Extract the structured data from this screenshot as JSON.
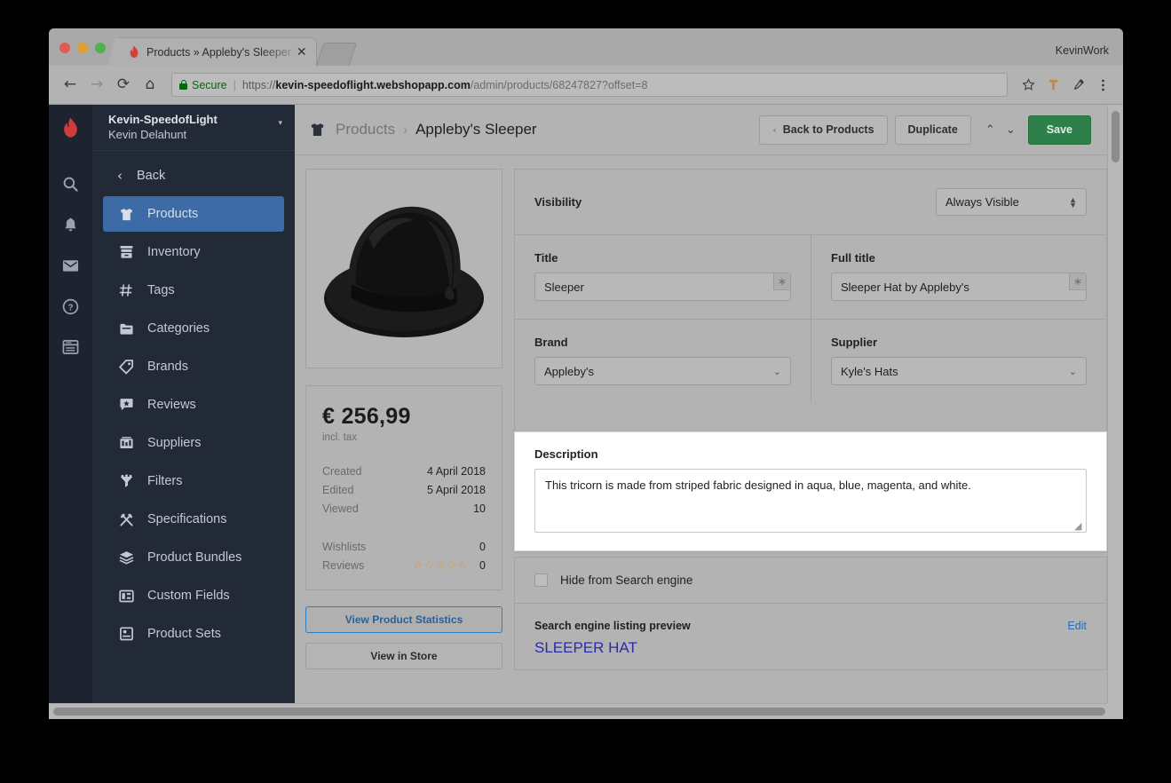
{
  "browser": {
    "traffic_lights": [
      "close",
      "minimize",
      "maximize"
    ],
    "tab": {
      "favicon": "flame-icon",
      "title": "Products » Appleby's Sleeper",
      "close_label": "✕"
    },
    "profile_label": "KevinWork",
    "nav": {
      "back": "←",
      "forward": "→",
      "reload": "⟳",
      "home": "⌂"
    },
    "url": {
      "secure_label": "Secure",
      "separator": "|",
      "scheme": "https://",
      "host": "kevin-speedoflight.webshopapp.com",
      "path": "/admin/products/68247827?offset=8",
      "full": "https://kevin-speedoflight.webshopapp.com/admin/products/68247827?offset=8"
    },
    "omni_icons": [
      "star-icon",
      "extension-icon",
      "eyedropper-icon",
      "menu-kebab-icon"
    ]
  },
  "rail": {
    "logo": "lightspeed-flame-logo",
    "icons": [
      {
        "name": "search-icon"
      },
      {
        "name": "notifications-bell-icon"
      },
      {
        "name": "mail-icon"
      },
      {
        "name": "help-icon"
      },
      {
        "name": "browser-window-icon"
      }
    ]
  },
  "sidebar": {
    "shop_name": "Kevin-SpeedofLight",
    "user_name": "Kevin Delahunt",
    "switcher_caret": "▾",
    "back_label": "Back",
    "items": [
      {
        "label": "Products",
        "icon": "tshirt-icon",
        "active": true
      },
      {
        "label": "Inventory",
        "icon": "inventory-box-icon",
        "active": false
      },
      {
        "label": "Tags",
        "icon": "hash-icon",
        "active": false
      },
      {
        "label": "Categories",
        "icon": "folder-icon",
        "active": false
      },
      {
        "label": "Brands",
        "icon": "tag-icon",
        "active": false
      },
      {
        "label": "Reviews",
        "icon": "review-star-bubble-icon",
        "active": false
      },
      {
        "label": "Suppliers",
        "icon": "suppliers-icon",
        "active": false
      },
      {
        "label": "Filters",
        "icon": "funnel-icon",
        "active": false
      },
      {
        "label": "Specifications",
        "icon": "tools-icon",
        "active": false
      },
      {
        "label": "Product Bundles",
        "icon": "layers-icon",
        "active": false
      },
      {
        "label": "Custom Fields",
        "icon": "custom-fields-icon",
        "active": false
      },
      {
        "label": "Product Sets",
        "icon": "product-sets-icon",
        "active": false
      }
    ]
  },
  "header": {
    "breadcrumb_icon": "tshirt-icon",
    "breadcrumb_parent": "Products",
    "breadcrumb_separator": "›",
    "breadcrumb_current": "Appleby's Sleeper",
    "back_to_products_label": "Back to Products",
    "back_chevron": "‹",
    "duplicate_label": "Duplicate",
    "prev_arrow": "⌃",
    "next_arrow": "⌄",
    "save_label": "Save"
  },
  "product_card": {
    "image_alt": "black-fedora-hat",
    "price": "€ 256,99",
    "price_note": "incl. tax",
    "stats": [
      {
        "key": "Created",
        "value": "4 April 2018"
      },
      {
        "key": "Edited",
        "value": "5 April 2018"
      },
      {
        "key": "Viewed",
        "value": "10"
      }
    ],
    "engagement": [
      {
        "key": "Wishlists",
        "value": "0",
        "stars": ""
      },
      {
        "key": "Reviews",
        "value": "0",
        "stars": "☆☆☆☆☆"
      }
    ],
    "view_statistics_label": "View Product Statistics",
    "view_in_store_label": "View in Store"
  },
  "form": {
    "visibility_label": "Visibility",
    "visibility_value": "Always Visible",
    "title_label": "Title",
    "title_value": "Sleeper",
    "title_required_marker": "∗",
    "full_title_label": "Full title",
    "full_title_value": "Sleeper Hat by Appleby's",
    "full_title_required_marker": "∗",
    "brand_label": "Brand",
    "brand_value": "Appleby's",
    "supplier_label": "Supplier",
    "supplier_value": "Kyle's Hats",
    "select_caret": "⌄",
    "description_label": "Description",
    "description_value": "This tricorn is made from striped fabric designed in aqua, blue, magenta, and white.",
    "resize_grip": "◢"
  },
  "seo": {
    "hide_label": "Hide from Search engine",
    "hide_checked": false,
    "preview_label": "Search engine listing preview",
    "edit_label": "Edit",
    "preview_title": "SLEEPER HAT"
  },
  "colors": {
    "rail_bg": "#1d2430",
    "sidebar_bg": "#222a37",
    "active_nav": "#3c6ba5",
    "save_green": "#2d8049",
    "link_blue": "#2a6bb5",
    "seo_title_blue": "#2b2ba8",
    "star_orange": "#e0963a",
    "secure_green": "#05650e",
    "page_bg": "#b3b3b3"
  }
}
